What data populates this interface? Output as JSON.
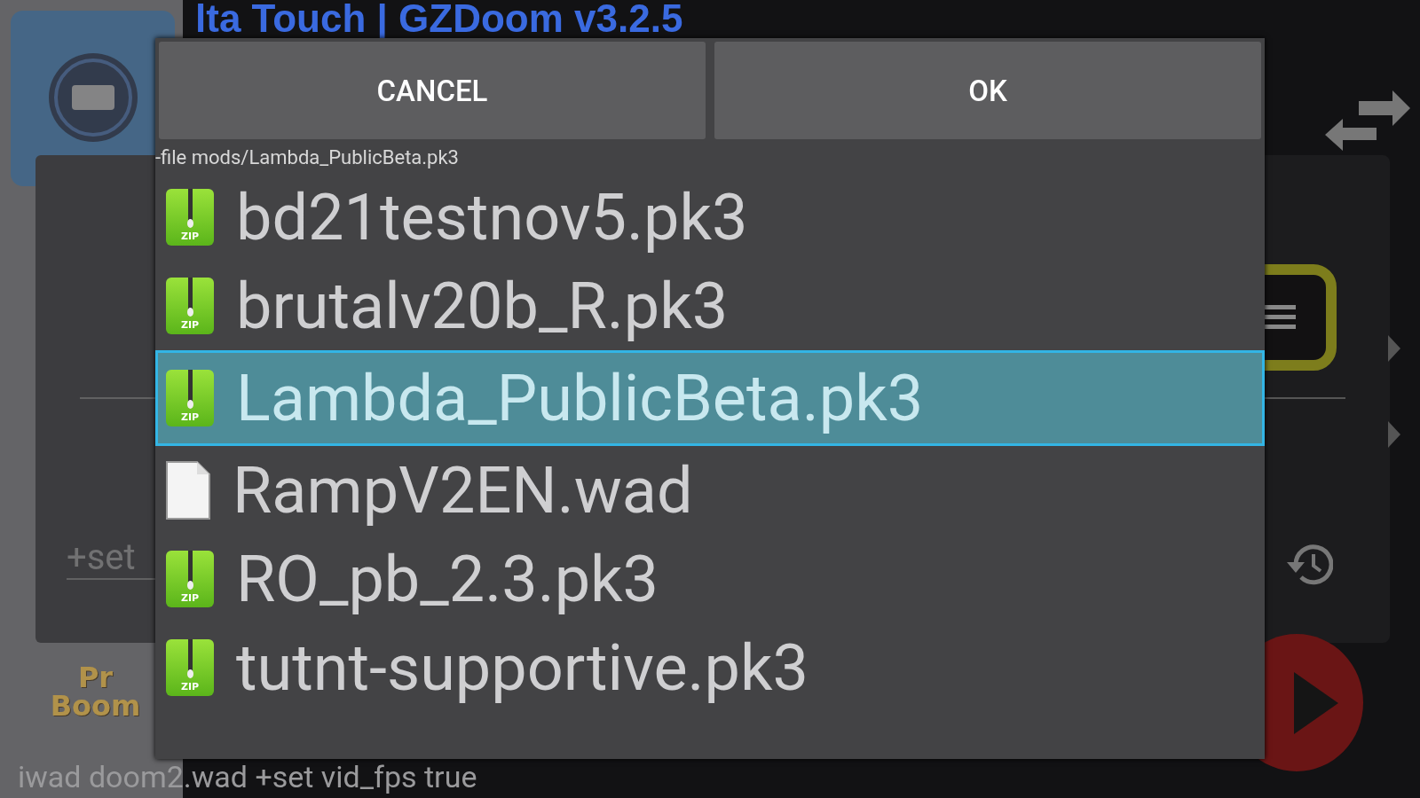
{
  "background": {
    "title": "lta Touch | GZDoom v3.2.5",
    "args_field": "+set",
    "logo_lines": [
      "Pr",
      "Boom"
    ],
    "command_line": "iwad doom2.wad  +set vid_fps true"
  },
  "dialog": {
    "buttons": [
      "CANCEL",
      "OK"
    ],
    "path": "-file mods/Lambda_PublicBeta.pk3",
    "files": [
      {
        "name": "bd21testnov5.pk3",
        "kind": "zip",
        "badge": "ZIP",
        "selected": false
      },
      {
        "name": "brutalv20b_R.pk3",
        "kind": "zip",
        "badge": "ZIP",
        "selected": false
      },
      {
        "name": "Lambda_PublicBeta.pk3",
        "kind": "zip",
        "badge": "ZIP",
        "selected": true
      },
      {
        "name": "RampV2EN.wad",
        "kind": "file",
        "selected": false
      },
      {
        "name": "RO_pb_2.3.pk3",
        "kind": "zip",
        "badge": "ZIP",
        "selected": false
      },
      {
        "name": "tutnt-supportive.pk3",
        "kind": "zip",
        "badge": "ZIP",
        "selected": false
      }
    ]
  }
}
